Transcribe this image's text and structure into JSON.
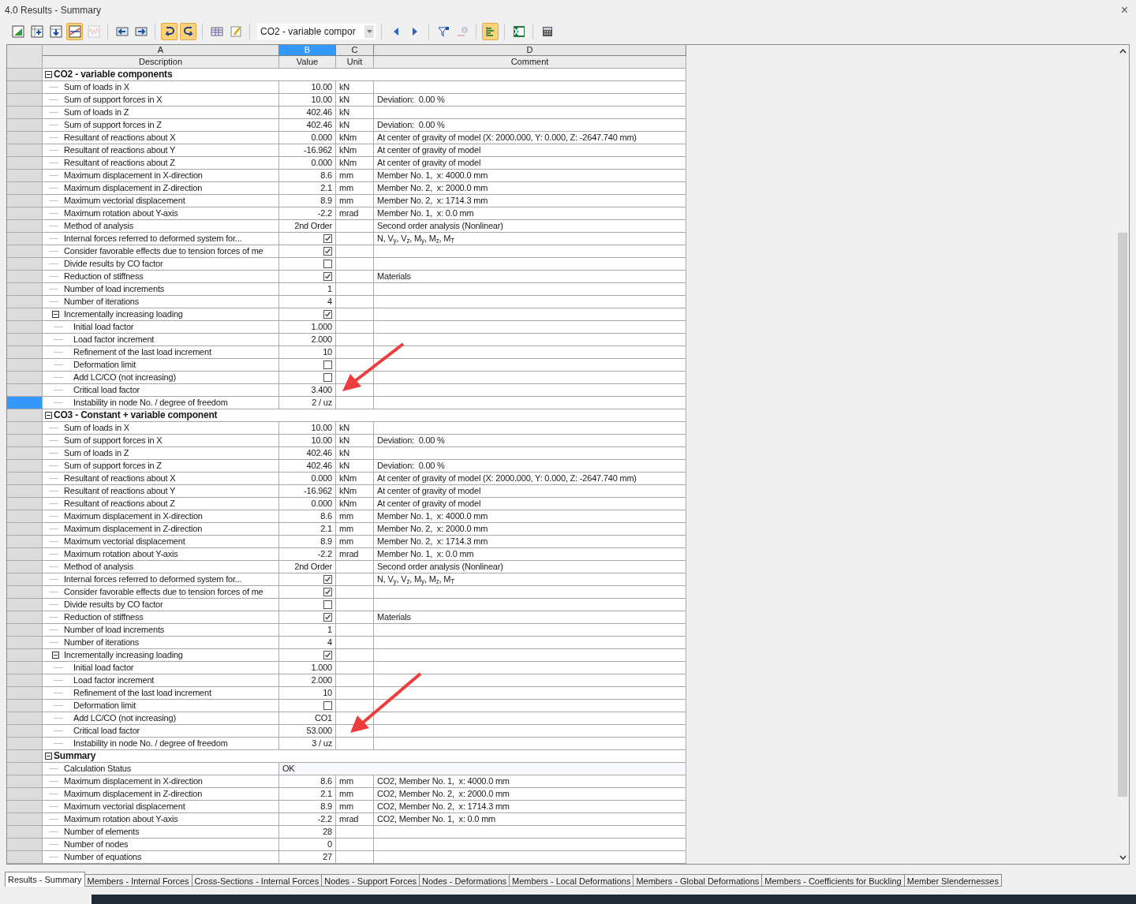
{
  "window": {
    "title": "4.0 Results - Summary",
    "close": "×"
  },
  "toolbar": [
    {
      "kind": "button",
      "pressed": false,
      "disabled": false
    },
    {
      "kind": "button",
      "pressed": false,
      "disabled": false
    },
    {
      "kind": "button",
      "pressed": false,
      "disabled": false
    },
    {
      "kind": "button",
      "pressed": true,
      "disabled": false
    },
    {
      "kind": "button",
      "pressed": false,
      "disabled": true
    },
    {
      "kind": "separator"
    },
    {
      "kind": "button",
      "pressed": false,
      "disabled": false
    },
    {
      "kind": "button",
      "pressed": false,
      "disabled": false
    },
    {
      "kind": "separator"
    },
    {
      "kind": "button",
      "pressed": true,
      "disabled": false
    },
    {
      "kind": "button",
      "pressed": true,
      "disabled": false
    },
    {
      "kind": "separator"
    },
    {
      "kind": "button",
      "pressed": false,
      "disabled": false
    },
    {
      "kind": "button",
      "pressed": false,
      "disabled": false
    },
    {
      "kind": "separator"
    },
    {
      "kind": "dropdown",
      "value": "CO2 - variable compor"
    },
    {
      "kind": "separator"
    },
    {
      "kind": "button",
      "pressed": false,
      "disabled": false
    },
    {
      "kind": "button",
      "pressed": false,
      "disabled": false
    },
    {
      "kind": "separator"
    },
    {
      "kind": "button",
      "pressed": false,
      "disabled": false
    },
    {
      "kind": "button",
      "pressed": false,
      "disabled": true
    },
    {
      "kind": "separator"
    },
    {
      "kind": "button",
      "pressed": true,
      "disabled": false
    },
    {
      "kind": "separator"
    },
    {
      "kind": "button",
      "pressed": false,
      "disabled": false
    },
    {
      "kind": "separator"
    },
    {
      "kind": "button",
      "pressed": false,
      "disabled": false
    }
  ],
  "table": {
    "columns": [
      {
        "letter": "A",
        "label": "Description",
        "selected": false
      },
      {
        "letter": "B",
        "label": "Value",
        "selected": true
      },
      {
        "letter": "C",
        "label": "Unit",
        "selected": false
      },
      {
        "letter": "D",
        "label": "Comment",
        "selected": false
      }
    ],
    "groups": [
      {
        "title": "CO2 - variable components",
        "expanded": true,
        "selected": false,
        "rows": [
          {
            "kind": "value",
            "description": "Sum of loads in X",
            "value": "10.00",
            "unit": "kN",
            "selected": false
          },
          {
            "kind": "value",
            "description": "Sum of support forces in X",
            "value": "10.00",
            "unit": "kN",
            "comment": "Deviation:  0.00 %",
            "selected": false
          },
          {
            "kind": "value",
            "description": "Sum of loads in Z",
            "value": "402.46",
            "unit": "kN",
            "selected": false
          },
          {
            "kind": "value",
            "description": "Sum of support forces in Z",
            "value": "402.46",
            "unit": "kN",
            "comment": "Deviation:  0.00 %",
            "selected": false
          },
          {
            "kind": "value",
            "description": "Resultant of reactions about X",
            "value": "0.000",
            "unit": "kNm",
            "comment": "At center of gravity of model (X: 2000.000, Y: 0.000, Z: -2647.740 mm)",
            "selected": false
          },
          {
            "kind": "value",
            "description": "Resultant of reactions about Y",
            "value": "-16.962",
            "unit": "kNm",
            "comment": "At center of gravity of model",
            "selected": false
          },
          {
            "kind": "value",
            "description": "Resultant of reactions about Z",
            "value": "0.000",
            "unit": "kNm",
            "comment": "At center of gravity of model",
            "selected": false
          },
          {
            "kind": "value",
            "description": "Maximum displacement in X-direction",
            "value": "8.6",
            "unit": "mm",
            "comment": "Member No. 1,  x: 4000.0 mm",
            "selected": false
          },
          {
            "kind": "value",
            "description": "Maximum displacement in Z-direction",
            "value": "2.1",
            "unit": "mm",
            "comment": "Member No. 2,  x: 2000.0 mm",
            "selected": false
          },
          {
            "kind": "value",
            "description": "Maximum vectorial displacement",
            "value": "8.9",
            "unit": "mm",
            "comment": "Member No. 2,  x: 1714.3 mm",
            "selected": false
          },
          {
            "kind": "value",
            "description": "Maximum rotation about Y-axis",
            "value": "-2.2",
            "unit": "mrad",
            "comment": "Member No. 1,  x: 0.0 mm",
            "selected": false
          },
          {
            "kind": "value",
            "description": "Method of analysis",
            "value": "2nd Order",
            "comment": "Second order analysis (Nonlinear)",
            "selected": false
          },
          {
            "kind": "check",
            "description": "Internal forces referred to deformed system for...",
            "checked": true,
            "comment": "N, V$_{y}$, V$_{z}$, M$_{y}$, M$_{z}$, M$_{T}$",
            "selected": false
          },
          {
            "kind": "check",
            "description": "Consider favorable effects due to tension forces of me",
            "checked": true,
            "selected": false
          },
          {
            "kind": "check",
            "description": "Divide results by CO factor",
            "checked": false,
            "selected": false
          },
          {
            "kind": "check",
            "description": "Reduction of stiffness",
            "checked": true,
            "comment": "Materials",
            "selected": false
          },
          {
            "kind": "value",
            "description": "Number of load increments",
            "value": "1",
            "selected": false
          },
          {
            "kind": "value",
            "description": "Number of iterations",
            "value": "4",
            "selected": false
          },
          {
            "kind": "check",
            "description": "Incrementally increasing loading",
            "checked": true,
            "expanded": true,
            "selected": false,
            "children": [
              {
                "kind": "value",
                "description": "Initial load factor",
                "value": "1.000",
                "selected": false
              },
              {
                "kind": "value",
                "description": "Load factor increment",
                "value": "2.000",
                "selected": false
              },
              {
                "kind": "value",
                "description": "Refinement of the last load increment",
                "value": "10",
                "selected": false
              },
              {
                "kind": "check",
                "description": "Deformation limit",
                "checked": false,
                "selected": false
              },
              {
                "kind": "check",
                "description": "Add LC/CO (not increasing)",
                "checked": false,
                "selected": false
              },
              {
                "kind": "value",
                "description": "Critical load factor",
                "value": "3.400",
                "selected": false
              },
              {
                "kind": "value",
                "description": "Instability in node No. / degree of freedom",
                "value": "2 / uz",
                "selected": true
              }
            ]
          }
        ]
      },
      {
        "title": "CO3 - Constant + variable component",
        "expanded": true,
        "selected": false,
        "rows": [
          {
            "kind": "value",
            "description": "Sum of loads in X",
            "value": "10.00",
            "unit": "kN",
            "selected": false
          },
          {
            "kind": "value",
            "description": "Sum of support forces in X",
            "value": "10.00",
            "unit": "kN",
            "comment": "Deviation:  0.00 %",
            "selected": false
          },
          {
            "kind": "value",
            "description": "Sum of loads in Z",
            "value": "402.46",
            "unit": "kN",
            "selected": false
          },
          {
            "kind": "value",
            "description": "Sum of support forces in Z",
            "value": "402.46",
            "unit": "kN",
            "comment": "Deviation:  0.00 %",
            "selected": false
          },
          {
            "kind": "value",
            "description": "Resultant of reactions about X",
            "value": "0.000",
            "unit": "kNm",
            "comment": "At center of gravity of model (X: 2000.000, Y: 0.000, Z: -2647.740 mm)",
            "selected": false
          },
          {
            "kind": "value",
            "description": "Resultant of reactions about Y",
            "value": "-16.962",
            "unit": "kNm",
            "comment": "At center of gravity of model",
            "selected": false
          },
          {
            "kind": "value",
            "description": "Resultant of reactions about Z",
            "value": "0.000",
            "unit": "kNm",
            "comment": "At center of gravity of model",
            "selected": false
          },
          {
            "kind": "value",
            "description": "Maximum displacement in X-direction",
            "value": "8.6",
            "unit": "mm",
            "comment": "Member No. 1,  x: 4000.0 mm",
            "selected": false
          },
          {
            "kind": "value",
            "description": "Maximum displacement in Z-direction",
            "value": "2.1",
            "unit": "mm",
            "comment": "Member No. 2,  x: 2000.0 mm",
            "selected": false
          },
          {
            "kind": "value",
            "description": "Maximum vectorial displacement",
            "value": "8.9",
            "unit": "mm",
            "comment": "Member No. 2,  x: 1714.3 mm",
            "selected": false
          },
          {
            "kind": "value",
            "description": "Maximum rotation about Y-axis",
            "value": "-2.2",
            "unit": "mrad",
            "comment": "Member No. 1,  x: 0.0 mm",
            "selected": false
          },
          {
            "kind": "value",
            "description": "Method of analysis",
            "value": "2nd Order",
            "comment": "Second order analysis (Nonlinear)",
            "selected": false
          },
          {
            "kind": "check",
            "description": "Internal forces referred to deformed system for...",
            "checked": true,
            "comment": "N, V$_{y}$, V$_{z}$, M$_{y}$, M$_{z}$, M$_{T}$",
            "selected": false
          },
          {
            "kind": "check",
            "description": "Consider favorable effects due to tension forces of me",
            "checked": true,
            "selected": false
          },
          {
            "kind": "check",
            "description": "Divide results by CO factor",
            "checked": false,
            "selected": false
          },
          {
            "kind": "check",
            "description": "Reduction of stiffness",
            "checked": true,
            "comment": "Materials",
            "selected": false
          },
          {
            "kind": "value",
            "description": "Number of load increments",
            "value": "1",
            "selected": false
          },
          {
            "kind": "value",
            "description": "Number of iterations",
            "value": "4",
            "selected": false
          },
          {
            "kind": "check",
            "description": "Incrementally increasing loading",
            "checked": true,
            "expanded": true,
            "selected": false,
            "children": [
              {
                "kind": "value",
                "description": "Initial load factor",
                "value": "1.000",
                "selected": false
              },
              {
                "kind": "value",
                "description": "Load factor increment",
                "value": "2.000",
                "selected": false
              },
              {
                "kind": "value",
                "description": "Refinement of the last load increment",
                "value": "10",
                "selected": false
              },
              {
                "kind": "check",
                "description": "Deformation limit",
                "checked": false,
                "selected": false
              },
              {
                "kind": "value",
                "description": "Add LC/CO (not increasing)",
                "value": "CO1",
                "selected": false
              },
              {
                "kind": "value",
                "description": "Critical load factor",
                "value": "53.000",
                "selected": false
              },
              {
                "kind": "value",
                "description": "Instability in node No. / degree of freedom",
                "value": "3 / uz",
                "selected": false
              }
            ]
          }
        ]
      },
      {
        "title": "Summary",
        "expanded": true,
        "selected": false,
        "rows": [
          {
            "kind": "span",
            "description": "Calculation Status",
            "value": "OK",
            "selected": false
          },
          {
            "kind": "value",
            "description": "Maximum displacement in X-direction",
            "value": "8.6",
            "unit": "mm",
            "comment": "CO2, Member No. 1,  x: 4000.0 mm",
            "selected": false
          },
          {
            "kind": "value",
            "description": "Maximum displacement in Z-direction",
            "value": "2.1",
            "unit": "mm",
            "comment": "CO2, Member No. 2,  x: 2000.0 mm",
            "selected": false
          },
          {
            "kind": "value",
            "description": "Maximum vectorial displacement",
            "value": "8.9",
            "unit": "mm",
            "comment": "CO2, Member No. 2,  x: 1714.3 mm",
            "selected": false
          },
          {
            "kind": "value",
            "description": "Maximum rotation about Y-axis",
            "value": "-2.2",
            "unit": "mrad",
            "comment": "CO2, Member No. 1,  x: 0.0 mm",
            "selected": false
          },
          {
            "kind": "value",
            "description": "Number of elements",
            "value": "28",
            "selected": false
          },
          {
            "kind": "value",
            "description": "Number of nodes",
            "value": "0",
            "selected": false
          },
          {
            "kind": "value",
            "description": "Number of equations",
            "value": "27",
            "selected": false
          }
        ]
      }
    ]
  },
  "tabs": [
    {
      "label": "Results - Summary",
      "selected": true
    },
    {
      "label": "Members - Internal Forces",
      "selected": false
    },
    {
      "label": "Cross-Sections - Internal Forces",
      "selected": false
    },
    {
      "label": "Nodes - Support Forces",
      "selected": false
    },
    {
      "label": "Nodes - Deformations",
      "selected": false
    },
    {
      "label": "Members - Local Deformations",
      "selected": false
    },
    {
      "label": "Members - Global Deformations",
      "selected": false
    },
    {
      "label": "Members - Coefficients for Buckling",
      "selected": false
    },
    {
      "label": "Member Slendernesses",
      "selected": false
    }
  ]
}
